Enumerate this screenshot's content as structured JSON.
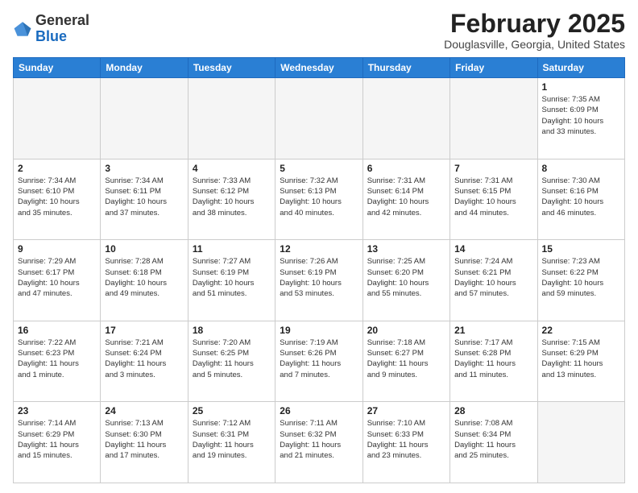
{
  "header": {
    "logo": {
      "general": "General",
      "blue": "Blue"
    },
    "title": "February 2025",
    "location": "Douglasville, Georgia, United States"
  },
  "calendar": {
    "days_of_week": [
      "Sunday",
      "Monday",
      "Tuesday",
      "Wednesday",
      "Thursday",
      "Friday",
      "Saturday"
    ],
    "weeks": [
      [
        {
          "day": "",
          "empty": true
        },
        {
          "day": "",
          "empty": true
        },
        {
          "day": "",
          "empty": true
        },
        {
          "day": "",
          "empty": true
        },
        {
          "day": "",
          "empty": true
        },
        {
          "day": "",
          "empty": true
        },
        {
          "day": "1",
          "info": "Sunrise: 7:35 AM\nSunset: 6:09 PM\nDaylight: 10 hours\nand 33 minutes."
        }
      ],
      [
        {
          "day": "2",
          "info": "Sunrise: 7:34 AM\nSunset: 6:10 PM\nDaylight: 10 hours\nand 35 minutes."
        },
        {
          "day": "3",
          "info": "Sunrise: 7:34 AM\nSunset: 6:11 PM\nDaylight: 10 hours\nand 37 minutes."
        },
        {
          "day": "4",
          "info": "Sunrise: 7:33 AM\nSunset: 6:12 PM\nDaylight: 10 hours\nand 38 minutes."
        },
        {
          "day": "5",
          "info": "Sunrise: 7:32 AM\nSunset: 6:13 PM\nDaylight: 10 hours\nand 40 minutes."
        },
        {
          "day": "6",
          "info": "Sunrise: 7:31 AM\nSunset: 6:14 PM\nDaylight: 10 hours\nand 42 minutes."
        },
        {
          "day": "7",
          "info": "Sunrise: 7:31 AM\nSunset: 6:15 PM\nDaylight: 10 hours\nand 44 minutes."
        },
        {
          "day": "8",
          "info": "Sunrise: 7:30 AM\nSunset: 6:16 PM\nDaylight: 10 hours\nand 46 minutes."
        }
      ],
      [
        {
          "day": "9",
          "info": "Sunrise: 7:29 AM\nSunset: 6:17 PM\nDaylight: 10 hours\nand 47 minutes."
        },
        {
          "day": "10",
          "info": "Sunrise: 7:28 AM\nSunset: 6:18 PM\nDaylight: 10 hours\nand 49 minutes."
        },
        {
          "day": "11",
          "info": "Sunrise: 7:27 AM\nSunset: 6:19 PM\nDaylight: 10 hours\nand 51 minutes."
        },
        {
          "day": "12",
          "info": "Sunrise: 7:26 AM\nSunset: 6:19 PM\nDaylight: 10 hours\nand 53 minutes."
        },
        {
          "day": "13",
          "info": "Sunrise: 7:25 AM\nSunset: 6:20 PM\nDaylight: 10 hours\nand 55 minutes."
        },
        {
          "day": "14",
          "info": "Sunrise: 7:24 AM\nSunset: 6:21 PM\nDaylight: 10 hours\nand 57 minutes."
        },
        {
          "day": "15",
          "info": "Sunrise: 7:23 AM\nSunset: 6:22 PM\nDaylight: 10 hours\nand 59 minutes."
        }
      ],
      [
        {
          "day": "16",
          "info": "Sunrise: 7:22 AM\nSunset: 6:23 PM\nDaylight: 11 hours\nand 1 minute."
        },
        {
          "day": "17",
          "info": "Sunrise: 7:21 AM\nSunset: 6:24 PM\nDaylight: 11 hours\nand 3 minutes."
        },
        {
          "day": "18",
          "info": "Sunrise: 7:20 AM\nSunset: 6:25 PM\nDaylight: 11 hours\nand 5 minutes."
        },
        {
          "day": "19",
          "info": "Sunrise: 7:19 AM\nSunset: 6:26 PM\nDaylight: 11 hours\nand 7 minutes."
        },
        {
          "day": "20",
          "info": "Sunrise: 7:18 AM\nSunset: 6:27 PM\nDaylight: 11 hours\nand 9 minutes."
        },
        {
          "day": "21",
          "info": "Sunrise: 7:17 AM\nSunset: 6:28 PM\nDaylight: 11 hours\nand 11 minutes."
        },
        {
          "day": "22",
          "info": "Sunrise: 7:15 AM\nSunset: 6:29 PM\nDaylight: 11 hours\nand 13 minutes."
        }
      ],
      [
        {
          "day": "23",
          "info": "Sunrise: 7:14 AM\nSunset: 6:29 PM\nDaylight: 11 hours\nand 15 minutes."
        },
        {
          "day": "24",
          "info": "Sunrise: 7:13 AM\nSunset: 6:30 PM\nDaylight: 11 hours\nand 17 minutes."
        },
        {
          "day": "25",
          "info": "Sunrise: 7:12 AM\nSunset: 6:31 PM\nDaylight: 11 hours\nand 19 minutes."
        },
        {
          "day": "26",
          "info": "Sunrise: 7:11 AM\nSunset: 6:32 PM\nDaylight: 11 hours\nand 21 minutes."
        },
        {
          "day": "27",
          "info": "Sunrise: 7:10 AM\nSunset: 6:33 PM\nDaylight: 11 hours\nand 23 minutes."
        },
        {
          "day": "28",
          "info": "Sunrise: 7:08 AM\nSunset: 6:34 PM\nDaylight: 11 hours\nand 25 minutes."
        },
        {
          "day": "",
          "empty": true
        }
      ]
    ]
  }
}
